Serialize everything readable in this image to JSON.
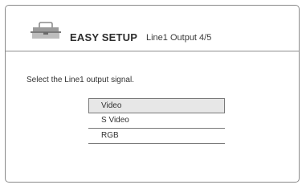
{
  "header": {
    "icon": "toolbox-icon",
    "title": "EASY SETUP",
    "subtitle": "Line1 Output 4/5"
  },
  "main": {
    "instruction": "Select the Line1 output signal.",
    "options": [
      {
        "label": "Video",
        "selected": true
      },
      {
        "label": "S Video",
        "selected": false
      },
      {
        "label": "RGB",
        "selected": false
      }
    ]
  }
}
